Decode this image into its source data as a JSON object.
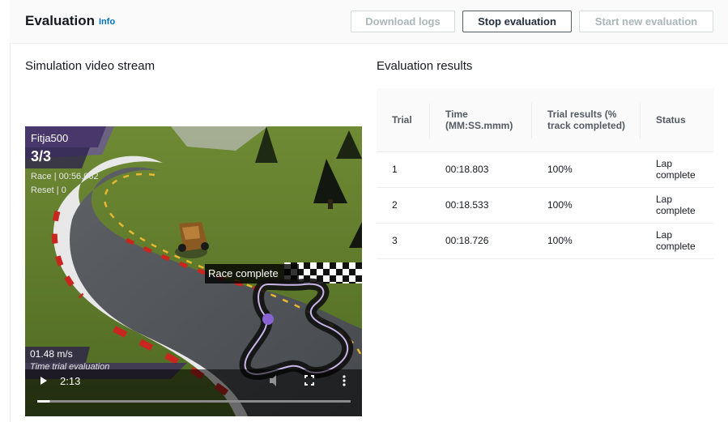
{
  "header": {
    "title": "Evaluation",
    "info": "Info",
    "buttons": {
      "download": "Download logs",
      "stop": "Stop evaluation",
      "start": "Start new evaluation"
    }
  },
  "video": {
    "section_title": "Simulation video stream",
    "overlay": {
      "model_name": "Fitja500",
      "lap": "3/3",
      "race_time": "Race | 00:56.062",
      "reset": "Reset | 0",
      "race_status": "Race complete",
      "speed": "01.48 m/s",
      "mode": "Time trial evaluation"
    },
    "controls": {
      "time": "2:13",
      "progress": 0.04
    }
  },
  "results": {
    "section_title": "Evaluation results",
    "columns": [
      "Trial",
      "Time (MM:SS.mmm)",
      "Trial results (% track completed)",
      "Status"
    ],
    "rows": [
      {
        "trial": "1",
        "time": "00:18.803",
        "result": "100%",
        "status": "Lap complete"
      },
      {
        "trial": "2",
        "time": "00:18.533",
        "result": "100%",
        "status": "Lap complete"
      },
      {
        "trial": "3",
        "time": "00:18.726",
        "result": "100%",
        "status": "Lap complete"
      }
    ]
  }
}
